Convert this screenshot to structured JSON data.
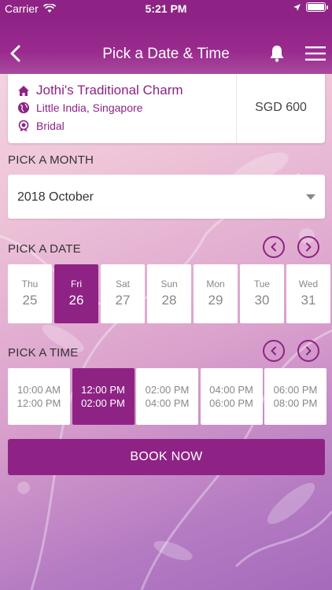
{
  "status_bar": {
    "carrier": "Carrier",
    "time": "5:21 PM"
  },
  "nav": {
    "title": "Pick a Date & Time"
  },
  "vendor": {
    "name": "Jothi's Traditional Charm",
    "location": "Little India, Singapore",
    "category": "Bridal",
    "price": "SGD 600"
  },
  "month": {
    "label": "PICK A MONTH",
    "selected": "2018 October"
  },
  "date": {
    "label": "PICK A DATE",
    "items": [
      {
        "dow": "Thu",
        "day": "25"
      },
      {
        "dow": "Fri",
        "day": "26"
      },
      {
        "dow": "Sat",
        "day": "27"
      },
      {
        "dow": "Sun",
        "day": "28"
      },
      {
        "dow": "Mon",
        "day": "29"
      },
      {
        "dow": "Tue",
        "day": "30"
      },
      {
        "dow": "Wed",
        "day": "31"
      }
    ],
    "selected_day": "26"
  },
  "time": {
    "label": "PICK A TIME",
    "slots": [
      {
        "start": "10:00 AM",
        "end": "12:00 PM"
      },
      {
        "start": "12:00 PM",
        "end": "02:00 PM"
      },
      {
        "start": "02:00 PM",
        "end": "04:00 PM"
      },
      {
        "start": "04:00 PM",
        "end": "06:00 PM"
      },
      {
        "start": "06:00 PM",
        "end": "08:00 PM"
      }
    ],
    "selected_start": "12:00 PM"
  },
  "book_button": "BOOK NOW",
  "colors": {
    "brand": "#8e2385",
    "tile_text": "#888888"
  },
  "icons": [
    "wifi-icon",
    "location-arrow-icon",
    "battery-icon",
    "back-arrow-icon",
    "bell-icon",
    "hamburger-menu-icon",
    "home-icon",
    "globe-icon",
    "ribbon-icon",
    "chevron-left-icon",
    "chevron-right-icon",
    "dropdown-caret-icon"
  ]
}
